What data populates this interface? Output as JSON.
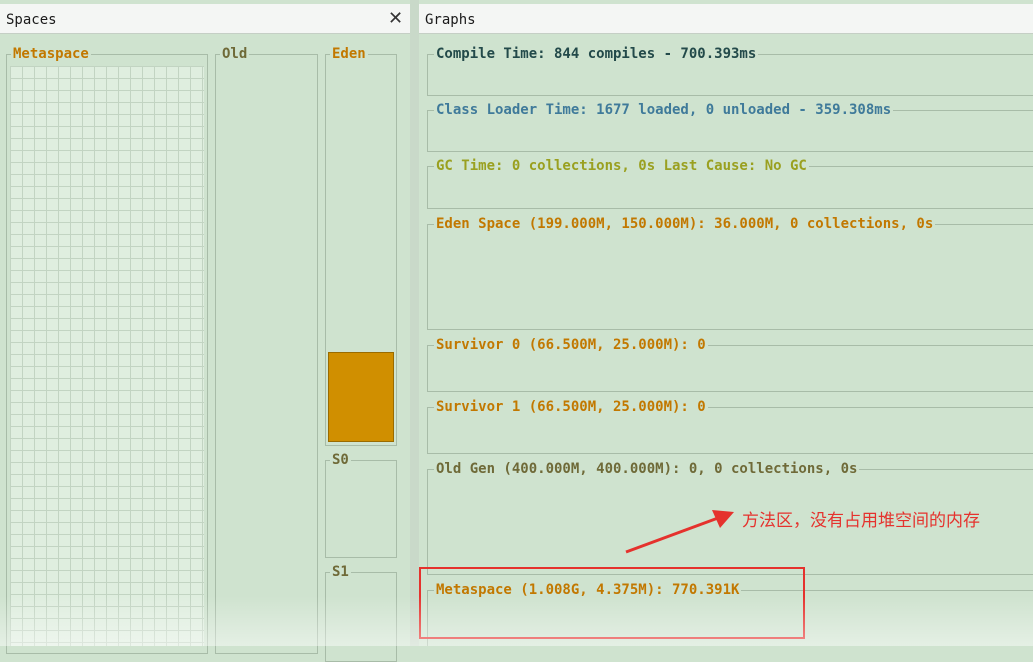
{
  "tabs": {
    "spaces_title": "Spaces",
    "graphs_title": "Graphs",
    "close_glyph": "✕"
  },
  "spaces": {
    "metaspace_label": "Metaspace",
    "old_label": "Old",
    "eden_label": "Eden",
    "s0_label": "S0",
    "s1_label": "S1"
  },
  "graphs": {
    "compile_time": "Compile Time: 844 compiles - 700.393ms",
    "class_loader_time": "Class Loader Time: 1677 loaded, 0 unloaded - 359.308ms",
    "gc_time": "GC Time: 0 collections, 0s Last Cause: No GC",
    "eden_space": "Eden Space (199.000M, 150.000M): 36.000M, 0 collections, 0s",
    "survivor_0": "Survivor 0 (66.500M, 25.000M): 0",
    "survivor_1": "Survivor 1 (66.500M, 25.000M): 0",
    "old_gen": "Old Gen (400.000M, 400.000M): 0, 0 collections, 0s",
    "metaspace": "Metaspace (1.008G, 4.375M): 770.391K"
  },
  "annotation": {
    "text": "方法区，没有占用堆空间的内存"
  },
  "colors": {
    "background": "#cfe3cf",
    "eden_fill": "#d08f00",
    "annotation_red": "#e5322d"
  }
}
